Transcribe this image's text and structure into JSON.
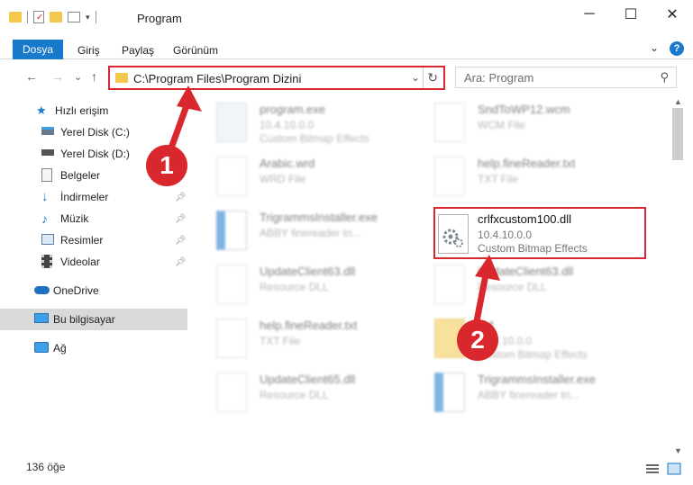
{
  "window": {
    "title": "Program",
    "controls": {
      "minimize": "─",
      "maximize": "☐",
      "close": "✕"
    }
  },
  "ribbon": {
    "tabs": [
      "Dosya",
      "Giriş",
      "Paylaş",
      "Görünüm"
    ],
    "expand": "⌄",
    "help": "?"
  },
  "nav": {
    "back": "←",
    "forward": "→",
    "recent": "⌄",
    "up": "↑",
    "address": "C:\\Program Files\\Program Dizini",
    "address_dropdown": "⌄",
    "refresh": "↻",
    "search_placeholder": "Ara: Program",
    "search_icon": "⚲"
  },
  "sidebar": {
    "items": [
      {
        "label": "Hızlı erişim",
        "icon": "star-icon"
      },
      {
        "label": "Yerel Disk (C:)",
        "icon": "drive-icon"
      },
      {
        "label": "Yerel Disk (D:)",
        "icon": "drive-icon"
      },
      {
        "label": "Belgeler",
        "icon": "documents-icon"
      },
      {
        "label": "İndirmeler",
        "icon": "download-icon"
      },
      {
        "label": "Müzik",
        "icon": "music-icon"
      },
      {
        "label": "Resimler",
        "icon": "pictures-icon"
      },
      {
        "label": "Videolar",
        "icon": "video-icon"
      },
      {
        "label": "OneDrive",
        "icon": "cloud-icon"
      },
      {
        "label": "Bu bilgisayar",
        "icon": "computer-icon"
      },
      {
        "label": "Ağ",
        "icon": "network-icon"
      }
    ]
  },
  "files": [
    {
      "name": "program.exe",
      "line1": "10.4.10.0.0",
      "line2": "Custom Bitmap Effects"
    },
    {
      "name": "SndToWP12.wcm",
      "line1": "WCM File",
      "line2": ""
    },
    {
      "name": "Arabic.wrd",
      "line1": "WRD File",
      "line2": ""
    },
    {
      "name": "help.fineReader.txt",
      "line1": "TXT File",
      "line2": ""
    },
    {
      "name": "TrigrammsInstaller.exe",
      "line1": "ABBY finereader tri...",
      "line2": ""
    },
    {
      "name": "crlfxcustom100.dll",
      "line1": "10.4.10.0.0",
      "line2": "Custom Bitmap Effects"
    },
    {
      "name": "UpdateClient63.dll",
      "line1": "Resource DLL",
      "line2": ""
    },
    {
      "name": "UpdateClient63.dll",
      "line1": "Resource DLL",
      "line2": ""
    },
    {
      "name": "help.fineReader.txt",
      "line1": "TXT File",
      "line2": ""
    },
    {
      "name": "...4",
      "line1": "10.4.10.0.0",
      "line2": "Custom Bitmap Effects"
    },
    {
      "name": "UpdateClient65.dll",
      "line1": "Resource DLL",
      "line2": ""
    },
    {
      "name": "TrigrammsInstaller.exe",
      "line1": "ABBY finereader tri...",
      "line2": ""
    }
  ],
  "status": {
    "count": "136 öğe"
  },
  "markers": {
    "one": "1",
    "two": "2"
  },
  "colors": {
    "accent": "#1979ca",
    "highlight": "#d9282d",
    "selected_bg": "#d9d9d9"
  }
}
